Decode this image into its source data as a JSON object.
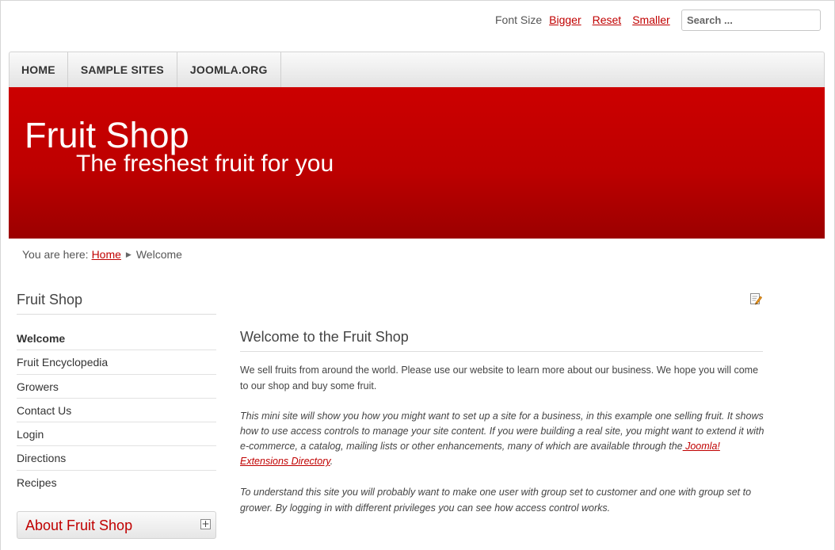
{
  "toolbar": {
    "font_size_label": "Font Size",
    "bigger": "Bigger",
    "reset": "Reset",
    "smaller": "Smaller",
    "search_placeholder": "Search ..."
  },
  "nav": {
    "items": [
      "HOME",
      "SAMPLE SITES",
      "JOOMLA.ORG"
    ]
  },
  "banner": {
    "title": "Fruit Shop",
    "tagline": "The freshest fruit for you",
    "color": "#c00000"
  },
  "breadcrumb": {
    "prefix": "You are here:",
    "home": "Home",
    "current": "Welcome"
  },
  "sidebar": {
    "title": "Fruit Shop",
    "items": [
      "Welcome",
      "Fruit Encyclopedia",
      "Growers",
      "Contact Us",
      "Login",
      "Directions",
      "Recipes"
    ],
    "active": "Welcome",
    "about_title": "About Fruit Shop",
    "about_toggle": "+"
  },
  "article": {
    "edit_icon": "edit-icon",
    "title": "Welcome to the Fruit Shop",
    "p1": "We sell fruits from around the world. Please use our website to learn more about our business. We hope you will come to our shop and buy some fruit.",
    "p2_text": "This mini site will show you how you might want to set up a site for a business, in this example one selling fruit. It shows how to use access controls to manage your site content. If you were building a real site, you might want to extend it with e-commerce, a catalog, mailing lists or other enhancements, many of which are available through the",
    "p2_link": " Joomla! Extensions Directory",
    "p2_end": ".",
    "p3": "To understand this site you will probably want to make one user with group set to customer and one with group set to grower. By logging in with different privileges you can see how access control works."
  }
}
